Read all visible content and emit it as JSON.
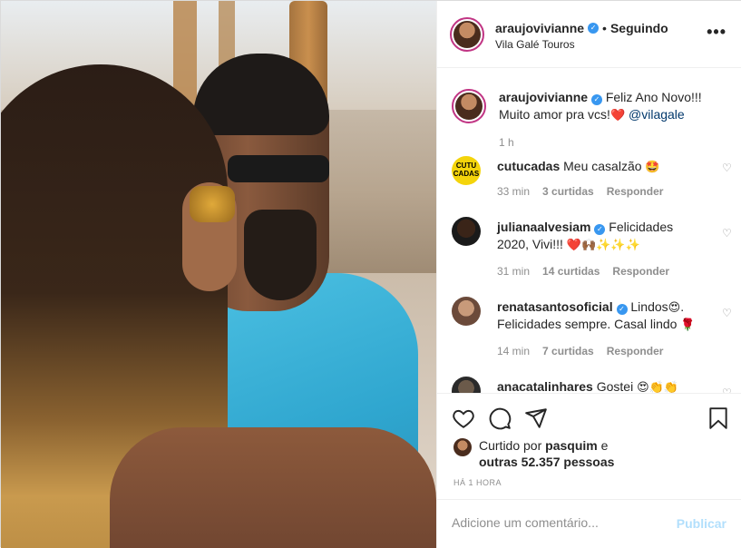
{
  "header": {
    "username": "araujovivianne",
    "separator": "•",
    "follow_status": "Seguindo",
    "location": "Vila Galé Touros",
    "more_icon": "more-horizontal-icon"
  },
  "caption": {
    "username": "araujovivianne",
    "text": "Feliz Ano Novo!!! Muito amor pra vcs!",
    "emoji": "❤️",
    "mention": "@vilagale",
    "time": "1 h"
  },
  "comments": [
    {
      "username": "cutucadas",
      "text": "Meu casalzão",
      "emoji": "🤩",
      "avatar_text": "CUTU CADAS",
      "time": "33 min",
      "likes": "3 curtidas",
      "reply": "Responder"
    },
    {
      "username": "julianaalvesiam",
      "text": "Felicidades 2020, Vivi!!!",
      "emoji": "❤️🙌🏾✨✨✨",
      "time": "31 min",
      "likes": "14 curtidas",
      "reply": "Responder"
    },
    {
      "username": "renatasantosoficial",
      "text": "Lindos",
      "emoji1": "😍",
      "text2": ". Felicidades sempre. Casal lindo",
      "emoji2": "🌹",
      "time": "14 min",
      "likes": "7 curtidas",
      "reply": "Responder"
    },
    {
      "username": "anacatalinhares",
      "text": "Gostei",
      "emoji": "😍👏👏"
    }
  ],
  "actions": {
    "liked_by_prefix": "Curtido por",
    "liked_by_user": "pasquim",
    "liked_by_suffix": "e",
    "others": "outras 52.357 pessoas",
    "ago": "HÁ 1 HORA"
  },
  "add_comment": {
    "placeholder": "Adicione um comentário...",
    "publish": "Publicar"
  },
  "colors": {
    "verified": "#3897f0",
    "link": "#00376b",
    "muted": "#8e8e8e",
    "publish_disabled": "#b2dffc"
  }
}
